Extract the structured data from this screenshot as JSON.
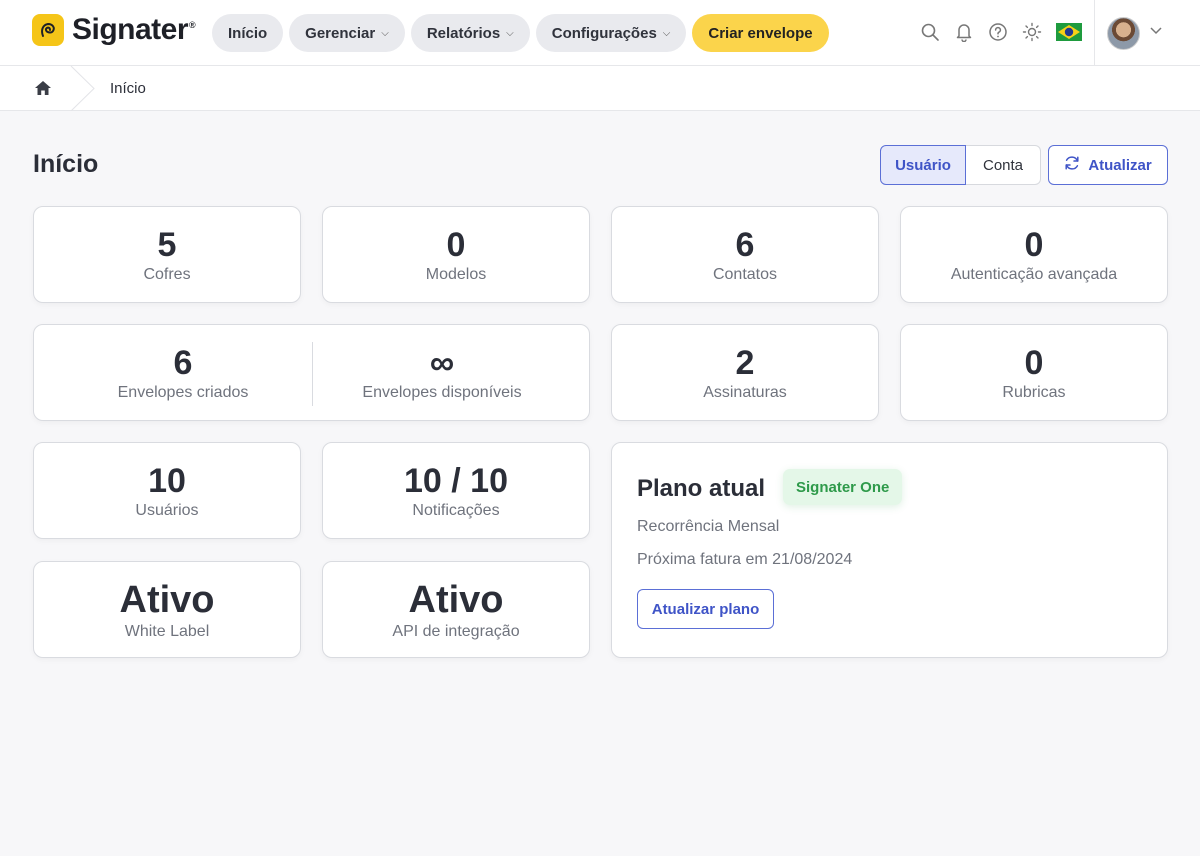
{
  "brand": {
    "name": "Signater",
    "reg": "®",
    "accent": "#fbd44b",
    "primary": "#3f54c7"
  },
  "nav": {
    "inicio": "Início",
    "gerenciar": "Gerenciar",
    "relatorios": "Relatórios",
    "configuracoes": "Configurações",
    "criar": "Criar envelope"
  },
  "topbar_icons": [
    "search-icon",
    "bell-icon",
    "help-icon",
    "sun-icon",
    "brazil-flag-icon",
    "avatar",
    "chevron-down-icon"
  ],
  "breadcrumb": {
    "current": "Início"
  },
  "page": {
    "title": "Início",
    "toggle_user": "Usuário",
    "toggle_account": "Conta",
    "refresh": "Atualizar"
  },
  "stats": {
    "cofres": {
      "value": "5",
      "label": "Cofres"
    },
    "modelos": {
      "value": "0",
      "label": "Modelos"
    },
    "contatos": {
      "value": "6",
      "label": "Contatos"
    },
    "autenticacao": {
      "value": "0",
      "label": "Autenticação avançada"
    },
    "env_criados": {
      "value": "6",
      "label": "Envelopes criados"
    },
    "env_disponiveis": {
      "value": "∞",
      "label": "Envelopes disponíveis"
    },
    "assinaturas": {
      "value": "2",
      "label": "Assinaturas"
    },
    "rubricas": {
      "value": "0",
      "label": "Rubricas"
    },
    "usuarios": {
      "value": "10",
      "label": "Usuários"
    },
    "notificacoes": {
      "value": "10 / 10",
      "label": "Notificações"
    },
    "white_label": {
      "value": "Ativo",
      "label": "White Label"
    },
    "api": {
      "value": "Ativo",
      "label": "API de integração"
    }
  },
  "plan": {
    "title": "Plano atual",
    "badge": "Signater One",
    "recurrence": "Recorrência Mensal",
    "next_invoice": "Próxima fatura em 21/08/2024",
    "button": "Atualizar plano"
  }
}
